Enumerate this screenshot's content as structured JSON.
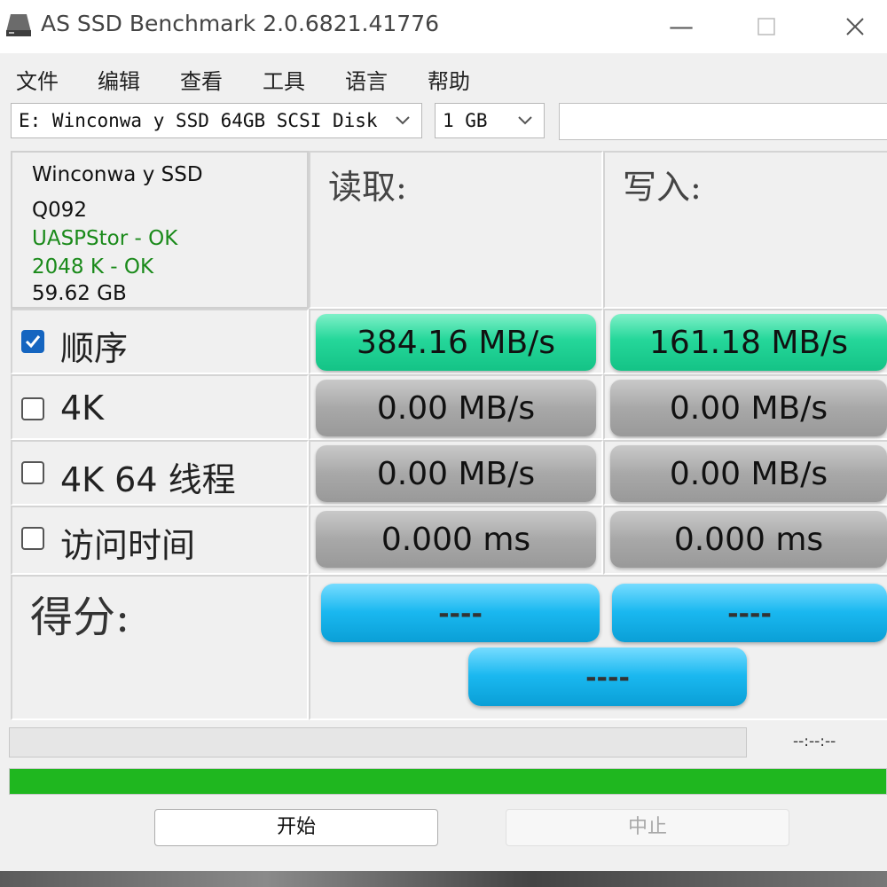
{
  "window": {
    "title": "AS SSD Benchmark 2.0.6821.41776",
    "min": "—",
    "max": "☐",
    "close": "✕"
  },
  "menu": [
    "文件",
    "编辑",
    "查看",
    "工具",
    "语言",
    "帮助"
  ],
  "toolbar": {
    "drive": "E: Winconwa y SSD 64GB SCSI Disk",
    "size": "1 GB"
  },
  "info": {
    "name": "Winconwa y SSD",
    "model": "Q092",
    "driver": "UASPStor - OK",
    "align": "2048 K - OK",
    "capacity": "59.62 GB"
  },
  "headers": {
    "read": "读取:",
    "write": "写入:"
  },
  "rows": [
    {
      "label": "顺序",
      "checked": true,
      "read": "384.16 MB/s",
      "write": "161.18 MB/s",
      "status": "done"
    },
    {
      "label": "4K",
      "checked": false,
      "read": "0.00 MB/s",
      "write": "0.00 MB/s",
      "status": "idle"
    },
    {
      "label": "4K 64 线程",
      "checked": false,
      "read": "0.00 MB/s",
      "write": "0.00 MB/s",
      "status": "idle"
    },
    {
      "label": "访问时间",
      "checked": false,
      "read": "0.000 ms",
      "write": "0.000 ms",
      "status": "idle"
    }
  ],
  "score": {
    "label": "得分:",
    "read": "----",
    "write": "----",
    "total": "----"
  },
  "progress": {
    "time": "--:--:--",
    "task_fraction": 0,
    "overall_fraction": 1.0
  },
  "buttons": {
    "start": "开始",
    "stop": "中止"
  },
  "colors": {
    "done": "#25d79a",
    "idle": "#a8a8a8",
    "score": "#1ab8f0",
    "progress": "#1fb71f",
    "checkbox": "#1565c0"
  }
}
